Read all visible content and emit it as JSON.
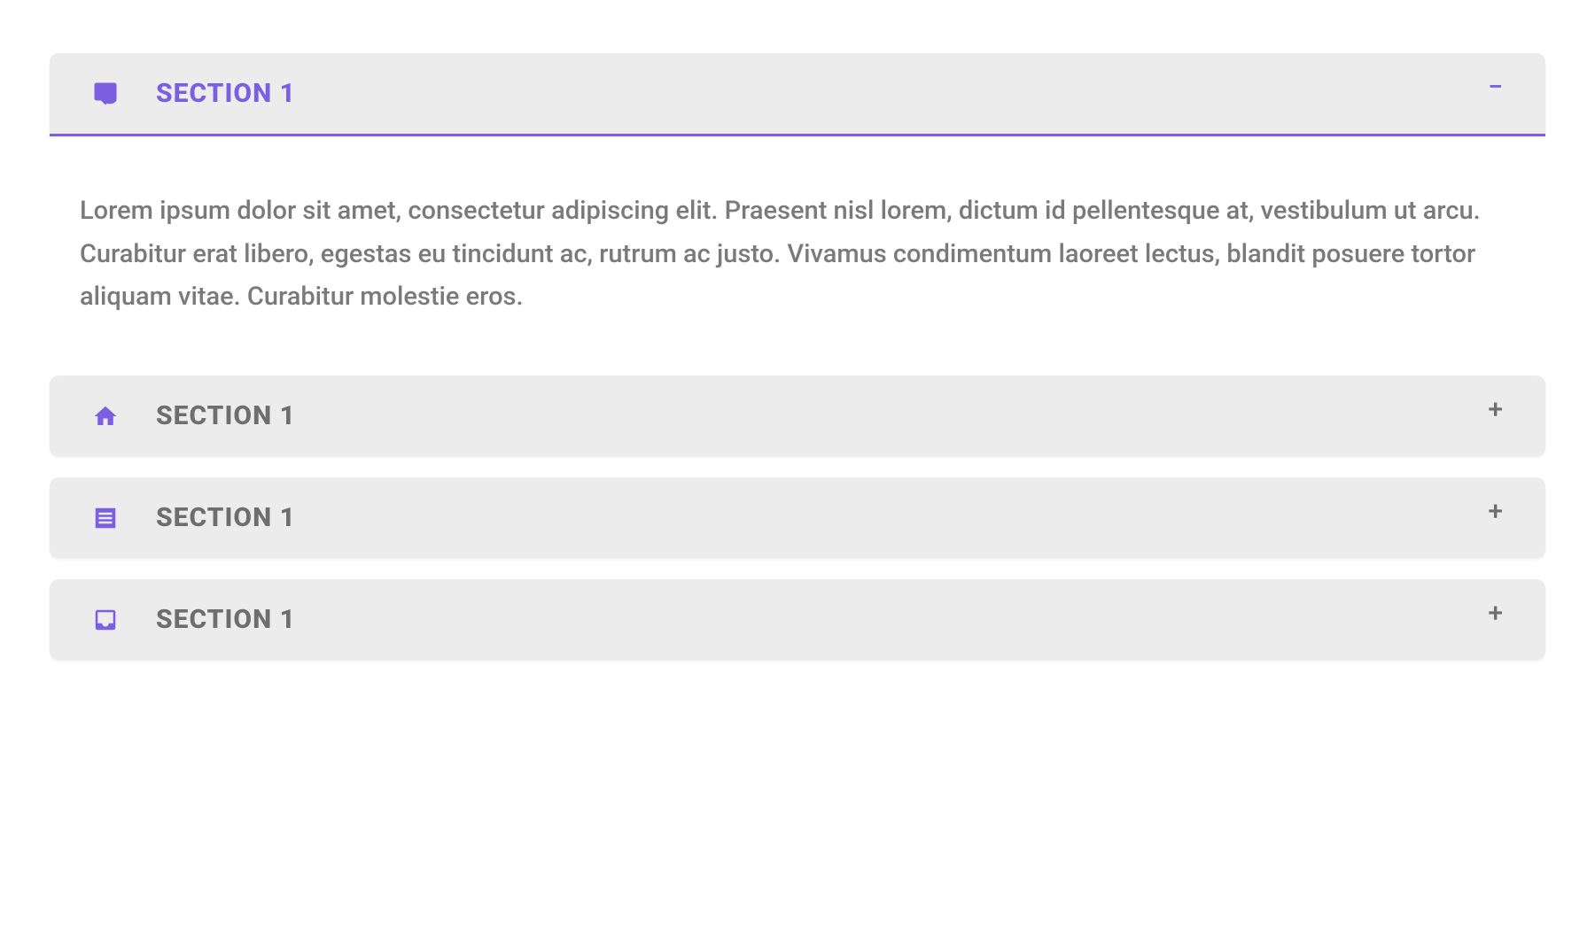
{
  "accordion": {
    "sections": [
      {
        "title": "SECTION 1",
        "expanded": true,
        "toggle": "−",
        "content": "Lorem ipsum dolor sit amet, consectetur adipiscing elit. Praesent nisl lorem, dictum id pellentesque at, vestibulum ut arcu. Curabitur erat libero, egestas eu tincidunt ac, rutrum ac justo. Vivamus condimentum laoreet lectus, blandit posuere tortor aliquam vitae. Curabitur molestie eros."
      },
      {
        "title": "SECTION 1",
        "expanded": false,
        "toggle": "+"
      },
      {
        "title": "SECTION 1",
        "expanded": false,
        "toggle": "+"
      },
      {
        "title": "SECTION 1",
        "expanded": false,
        "toggle": "+"
      }
    ]
  },
  "colors": {
    "accent": "#7a5fe0",
    "headerBg": "#ececec",
    "text": "#6e6e6e",
    "bodyText": "#7a7a7a"
  }
}
